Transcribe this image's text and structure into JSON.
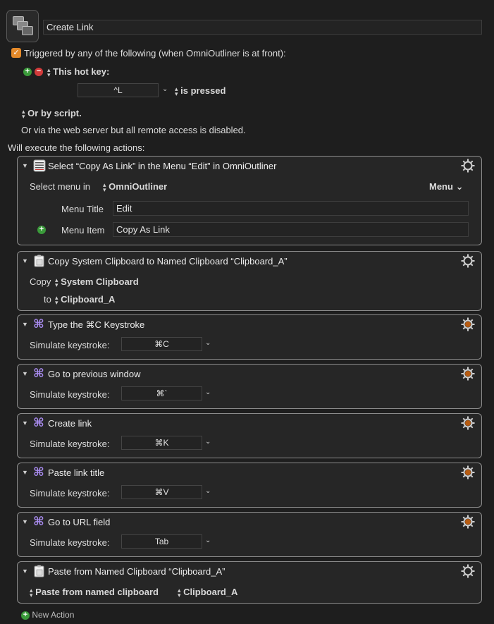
{
  "macro": {
    "name": "Create Link"
  },
  "trigger": {
    "checkbox_label": "Triggered by any of the following (when OmniOutliner is at front):",
    "hotkey_label": "This hot key:",
    "hotkey_value": "^L",
    "hotkey_mode": "is pressed",
    "script_label": "Or by script.",
    "webserver_label": "Or via the web server but all remote access is disabled."
  },
  "actions_header": "Will execute the following actions:",
  "actions": [
    {
      "title": "Select “Copy As Link” in the Menu “Edit” in OmniOutliner",
      "select_menu_label": "Select menu in",
      "app": "OmniOutliner",
      "menu_button": "Menu",
      "menu_title_label": "Menu Title",
      "menu_title_value": "Edit",
      "menu_item_label": "Menu Item",
      "menu_item_value": "Copy As Link"
    },
    {
      "title": "Copy System Clipboard to Named Clipboard “Clipboard_A”",
      "copy_label": "Copy",
      "copy_source": "System Clipboard",
      "to_label": "to",
      "to_target": "Clipboard_A"
    },
    {
      "title": "Type the ⌘C Keystroke",
      "sim_label": "Simulate keystroke:",
      "key": "⌘C"
    },
    {
      "title": "Go to previous window",
      "sim_label": "Simulate keystroke:",
      "key": "⌘`"
    },
    {
      "title": "Create link",
      "sim_label": "Simulate keystroke:",
      "key": "⌘K"
    },
    {
      "title": "Paste link title",
      "sim_label": "Simulate keystroke:",
      "key": "⌘V"
    },
    {
      "title": "Go to URL field",
      "sim_label": "Simulate keystroke:",
      "key": "Tab"
    },
    {
      "title": "Paste from Named Clipboard “Clipboard_A”",
      "paste_label": "Paste from named clipboard",
      "clipboard": "Clipboard_A"
    }
  ],
  "new_action_label": "New Action",
  "colors": {
    "background": "#1e1e1e",
    "accent_orange": "#e58a2a",
    "command_icon": "#a98cf0",
    "add_green": "#3a9a3a",
    "remove_red": "#d23b3b"
  },
  "icons": [
    "macro-icon",
    "checkbox-icon",
    "plus-icon",
    "minus-icon",
    "command-key-icon",
    "clipboard-icon",
    "menu-list-icon",
    "gear-icon",
    "disclosure-triangle-icon"
  ]
}
